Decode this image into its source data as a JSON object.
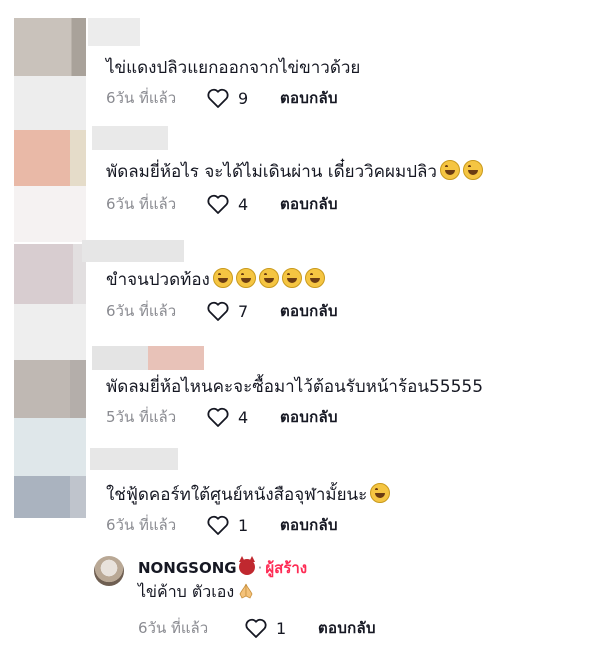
{
  "comments": [
    {
      "text": "ไข่แดงปลิวแยกออกจากไข่ขาวด้วย",
      "time": "6วัน ที่แล้ว",
      "likes": "9",
      "reply": "ตอบกลับ",
      "emoji_count": 0
    },
    {
      "text": "พัดลมยี่ห้อไร จะได้ไม่เดินผ่าน เดี๋ยววิคผมปลิว",
      "time": "6วัน ที่แล้ว",
      "likes": "4",
      "reply": "ตอบกลับ",
      "emoji_count": 2
    },
    {
      "text": "ขำจนปวดท้อง",
      "time": "6วัน ที่แล้ว",
      "likes": "7",
      "reply": "ตอบกลับ",
      "emoji_count": 5
    },
    {
      "text": "พัดลมยี่ห้อไหนคะจะซื้อมาไว้ต้อนรับหน้าร้อน55555",
      "time": "5วัน ที่แล้ว",
      "likes": "4",
      "reply": "ตอบกลับ",
      "emoji_count": 0
    },
    {
      "text": "ใช่ฟู้ดคอร์ทใต้ศูนย์หนังสือจุฬามั้ยนะ",
      "time": "6วัน ที่แล้ว",
      "likes": "1",
      "reply": "ตอบกลับ",
      "emoji_count": 1
    }
  ],
  "author_reply": {
    "username": "NONGSONG",
    "badge_separator": "·",
    "creator_label": "ผู้สร้าง",
    "text": "ไข่ค้าบ ตัวเอง",
    "time": "6วัน ที่แล้ว",
    "likes": "1",
    "reply": "ตอบกลับ"
  }
}
